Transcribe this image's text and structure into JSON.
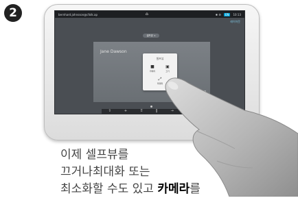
{
  "step": {
    "number": "2"
  },
  "status_bar": {
    "address": "bernhard.johnsson@cfolk.ap",
    "home_glyph": "⌂",
    "icons": "✱ ⚙",
    "language": "EN",
    "time": "10:13"
  },
  "layout_link": "레이아웃",
  "selfview_tab": "셀프뷰 ∨",
  "remote_participant": "Jane Dawson",
  "selfview_menu": {
    "title": "셀프뷰",
    "buttons": [
      {
        "label": "카메라",
        "icon": "camera-icon",
        "glyph": "■"
      },
      {
        "label": "끄기",
        "icon": "selfview-off-icon",
        "glyph": "▣"
      },
      {
        "label": "최대화",
        "icon": "maximize-icon",
        "glyph": "⤢"
      }
    ]
  },
  "call_controls": [
    {
      "label": "공유",
      "icon": "share-icon",
      "glyph": "⇧"
    },
    {
      "label": "추가",
      "icon": "add-icon",
      "glyph": "+"
    },
    {
      "label": "키패드",
      "icon": "keypad-icon",
      "glyph": "⠿"
    },
    {
      "label": "보류",
      "icon": "hold-icon",
      "glyph": "‖"
    },
    {
      "label": "전송",
      "icon": "transfer-icon",
      "glyph": "→"
    }
  ],
  "end_call_label": "종료",
  "caption": {
    "line1": "이제 셀프뷰를",
    "line2": "끄거나최대화 또는",
    "line3_pre": "최소화할 수도 있고 ",
    "line3_bold": "카메라",
    "line3_post": "를"
  },
  "colors": {
    "screen_bg": "#4a4e53",
    "accent_blue": "#00a2d8",
    "end_call_red": "#e0393e"
  }
}
